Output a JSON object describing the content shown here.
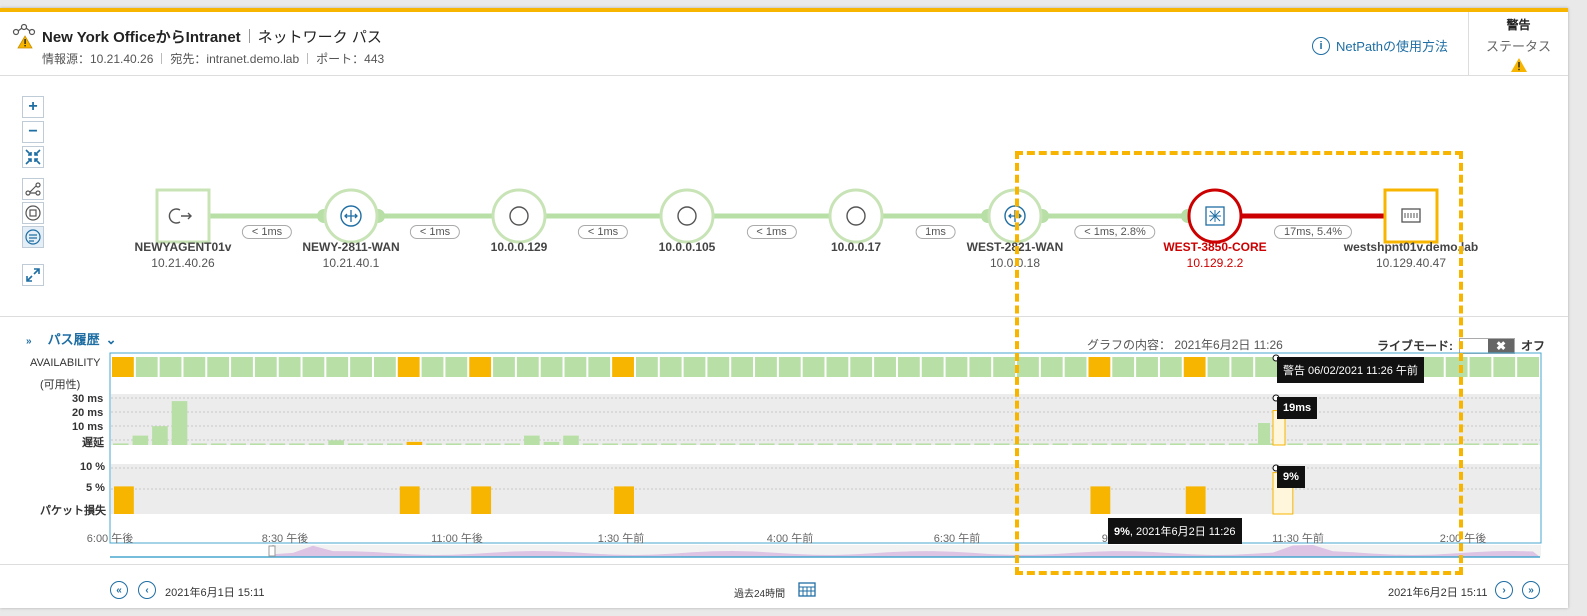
{
  "header": {
    "title_main": "New York OfficeからIntranet",
    "title_sub": "ネットワーク パス",
    "source": "情報源：10.21.40.26",
    "destination": "宛先：intranet.demo.lab",
    "port": "ポート：443",
    "help_label": "NetPathの使用方法",
    "status_title": "警告",
    "status_label": "ステータス"
  },
  "colors": {
    "accent": "#f7b500",
    "ok": "#b7dfa6",
    "ok_border": "#c8e4b6",
    "critical": "#cc0000",
    "link": "#1f6ea3"
  },
  "path": {
    "nodes": [
      {
        "name": "NEWYAGENT01v",
        "ip": "10.21.40.26",
        "icon": "agent-icon",
        "state": "ok"
      },
      {
        "name": "NEWY-2811-WAN",
        "ip": "10.21.40.1",
        "icon": "router-icon",
        "state": "ok"
      },
      {
        "name": "10.0.0.129",
        "ip": "",
        "icon": "hop-icon",
        "state": "ok"
      },
      {
        "name": "10.0.0.105",
        "ip": "",
        "icon": "hop-icon",
        "state": "ok"
      },
      {
        "name": "10.0.0.17",
        "ip": "",
        "icon": "hop-icon",
        "state": "ok"
      },
      {
        "name": "WEST-2821-WAN",
        "ip": "10.0.0.18",
        "icon": "router-icon",
        "state": "ok"
      },
      {
        "name": "WEST-3850-CORE",
        "ip": "10.129.2.2",
        "icon": "switch-icon",
        "state": "critical"
      },
      {
        "name": "westshpnt01v.demo.lab",
        "ip": "10.129.40.47",
        "icon": "server-icon",
        "state": "warning"
      }
    ],
    "links": [
      "< 1ms",
      "< 1ms",
      "< 1ms",
      "< 1ms",
      "1ms",
      "< 1ms, 2.8%",
      "17ms, 5.4%"
    ]
  },
  "history": {
    "title": "パス履歴",
    "graph_time": "グラフの内容： 2021年6月2日 11:26",
    "live_mode_label": "ライブモード:",
    "live_mode_state": "オフ",
    "availability_label": "AVAILABILITY",
    "availability_label_ja": "(可用性)",
    "latency_ticks": [
      "30 ms",
      "20 ms",
      "10 ms"
    ],
    "latency_label": "遅延",
    "loss_ticks": [
      "10 %",
      "5 %"
    ],
    "loss_label": "パケット損失",
    "x_ticks": [
      "6:00 午後",
      "8:30 午後",
      "11:00 午後",
      "1:30 午前",
      "4:00 午前",
      "6:30 午前",
      "9:00 午前",
      "11:30 午前",
      "2:00 午後"
    ],
    "tooltip_status": "警告 06/02/2021 11:26 午前",
    "tooltip_latency": "19ms",
    "tooltip_loss": "9%",
    "tooltip_bottom_value": "9%",
    "tooltip_bottom_time": ", 2021年6月2日 11:26",
    "range_label": "過去24時間",
    "start_time": "2021年6月1日 15:11",
    "end_time": "2021年6月2日 15:11"
  },
  "chart_data": {
    "type": "bar",
    "samples": 60,
    "availability_warning_indices": [
      0,
      12,
      15,
      21,
      41,
      45
    ],
    "latency_ms": [
      1,
      6,
      12,
      28,
      1,
      1,
      1,
      1,
      1,
      1,
      1,
      3,
      1,
      1,
      1,
      2,
      1,
      1,
      1,
      1,
      1,
      6,
      2,
      6,
      1,
      1,
      1,
      1,
      1,
      1,
      1,
      1,
      1,
      1,
      1,
      1,
      1,
      1,
      1,
      1,
      1,
      1,
      1,
      1,
      1,
      1,
      1,
      1,
      1,
      1,
      1,
      1,
      1,
      1,
      1,
      1,
      1,
      1,
      1,
      1,
      1,
      1,
      1,
      1,
      1,
      1,
      1,
      1,
      1,
      1,
      1,
      1,
      1
    ],
    "loss_percent_nonzero": {
      "0": 6,
      "12": 6,
      "15": 6,
      "21": 6,
      "41": 6,
      "45": 6,
      "49": 9
    },
    "ylim_latency": [
      0,
      30
    ],
    "ylim_loss": [
      0,
      10
    ]
  }
}
